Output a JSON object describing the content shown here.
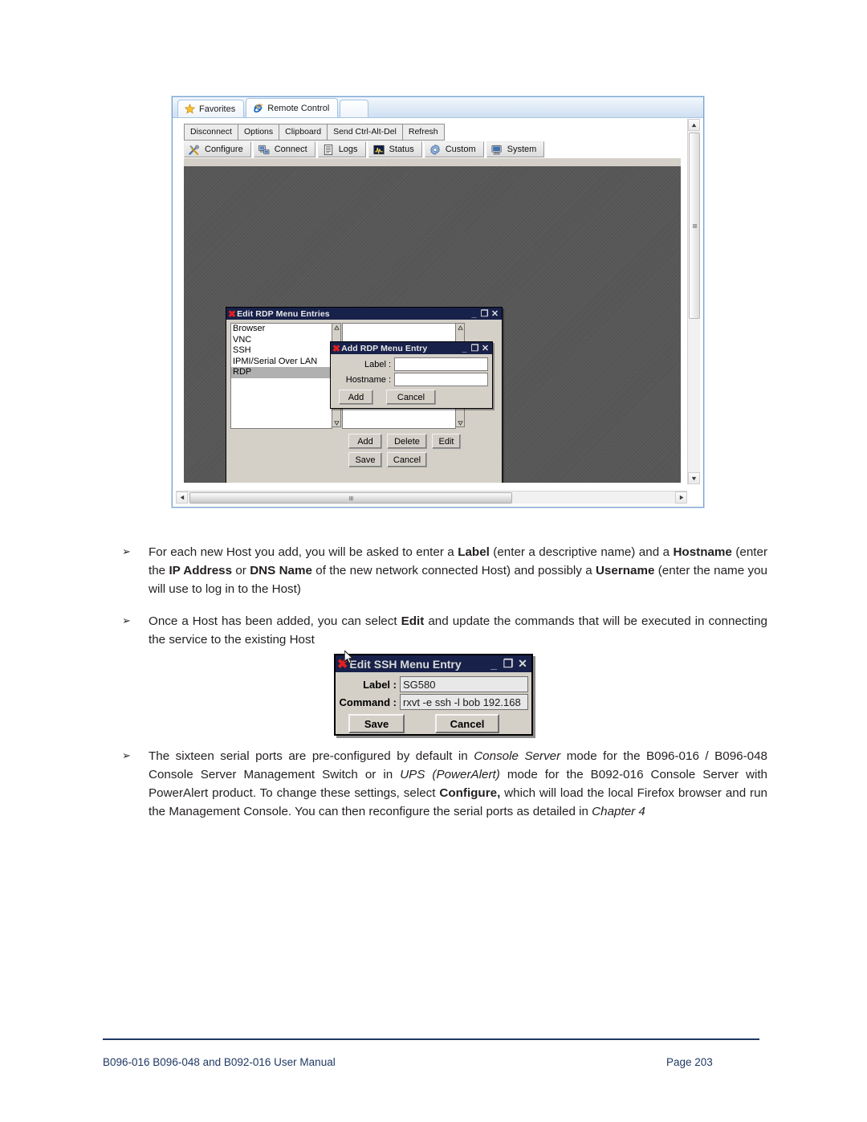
{
  "browser": {
    "tabs": [
      {
        "label": "Favorites",
        "icon": "star-icon"
      },
      {
        "label": "Remote Control",
        "icon": "internet-explorer-icon"
      },
      {
        "label": "",
        "icon": "blank-tab"
      }
    ],
    "toolbar_row1": [
      "Disconnect",
      "Options",
      "Clipboard",
      "Send Ctrl-Alt-Del",
      "Refresh"
    ],
    "toolbar_row2": [
      {
        "label": "Configure",
        "icon": "wrench-screwdriver-icon"
      },
      {
        "label": "Connect",
        "icon": "network-computer-icon"
      },
      {
        "label": "Logs",
        "icon": "document-icon"
      },
      {
        "label": "Status",
        "icon": "waveform-icon"
      },
      {
        "label": "Custom",
        "icon": "gear-icon"
      },
      {
        "label": "System",
        "icon": "monitor-icon"
      }
    ]
  },
  "edit_rdp_dialog": {
    "title": "Edit RDP Menu Entries",
    "titlebar_buttons": [
      "_",
      "❐",
      "✕"
    ],
    "list_items": [
      "Browser",
      "VNC",
      "SSH",
      "IPMI/Serial Over LAN",
      "RDP"
    ],
    "selected_item": "RDP",
    "buttons": [
      "Add",
      "Delete",
      "Edit",
      "Save",
      "Cancel"
    ]
  },
  "add_rdp_dialog": {
    "title": "Add RDP Menu Entry",
    "titlebar_buttons": [
      "_",
      "❐",
      "✕"
    ],
    "fields": [
      {
        "label": "Label :",
        "value": ""
      },
      {
        "label": "Hostname :",
        "value": ""
      }
    ],
    "buttons": [
      "Add",
      "Cancel"
    ]
  },
  "edit_ssh_dialog": {
    "title": "Edit SSH Menu Entry",
    "titlebar_buttons": [
      "_",
      "❐",
      "✕"
    ],
    "fields": [
      {
        "label": "Label :",
        "value": "SG580"
      },
      {
        "label": "Command :",
        "value": "rxvt -e ssh -l bob 192.168"
      }
    ],
    "buttons": [
      "Save",
      "Cancel"
    ]
  },
  "content": {
    "bullet_marker": "➢",
    "bullets": [
      {
        "id": "bullet-host-label",
        "parts": [
          {
            "t": "For each new Host you add, you will be asked to enter a ",
            "s": "n"
          },
          {
            "t": "Label",
            "s": "b"
          },
          {
            "t": " (enter a descriptive name) and a ",
            "s": "n"
          },
          {
            "t": "Hostname",
            "s": "b"
          },
          {
            "t": " (enter the ",
            "s": "n"
          },
          {
            "t": "IP Address",
            "s": "b"
          },
          {
            "t": " or ",
            "s": "n"
          },
          {
            "t": "DNS Name",
            "s": "b"
          },
          {
            "t": " of the new network connected Host) and possibly a ",
            "s": "n"
          },
          {
            "t": "Username",
            "s": "b"
          },
          {
            "t": " (enter the name you will use to log in to the Host)",
            "s": "n"
          }
        ]
      },
      {
        "id": "bullet-edit-commands",
        "parts": [
          {
            "t": "Once a Host has been added, you can select ",
            "s": "n"
          },
          {
            "t": "Edit",
            "s": "b"
          },
          {
            "t": " and update the commands that will be executed in connecting the service to the existing Host",
            "s": "n"
          }
        ]
      }
    ],
    "bullet_serial_ports": {
      "id": "bullet-serial-ports",
      "parts": [
        {
          "t": "The sixteen serial ports are pre-configured by default in ",
          "s": "n"
        },
        {
          "t": "Console Server",
          "s": "i"
        },
        {
          "t": " mode for the B096-016 / B096-048 Console Server Management Switch or in ",
          "s": "n"
        },
        {
          "t": "UPS (PowerAlert)",
          "s": "i"
        },
        {
          "t": " mode for the B092-016 Console Server with PowerAlert product. To change these settings, select ",
          "s": "n"
        },
        {
          "t": "Configure,",
          "s": "b"
        },
        {
          "t": " which will load the local Firefox browser and run the Management Console. You can then reconfigure the serial ports as detailed in ",
          "s": "n"
        },
        {
          "t": "Chapter 4",
          "s": "i"
        }
      ]
    }
  },
  "footer": {
    "left": "B096-016 B096-048 and B092-016 User Manual",
    "right": "Page 203"
  },
  "colors": {
    "titlebar": "#18214a",
    "x_red": "#e02020",
    "footer_navy": "#1f3864",
    "dialog_face": "#d4d0c8",
    "desktop": "#585858"
  }
}
